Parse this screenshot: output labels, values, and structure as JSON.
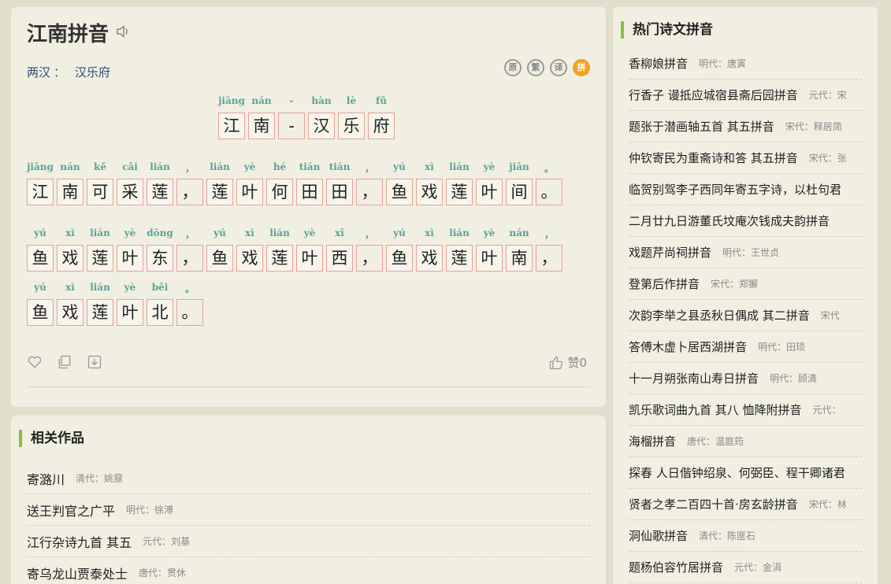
{
  "poem": {
    "title": "江南拼音",
    "dynasty": "两汉",
    "meta_sep": "：",
    "author": "汉乐府",
    "tools": [
      "原",
      "繁",
      "译",
      "拼"
    ],
    "title_line": {
      "py": [
        "jiāng",
        "nán",
        "-",
        "hàn",
        "lè",
        "fǔ"
      ],
      "hz": [
        "江",
        "南",
        "-",
        "汉",
        "乐",
        "府"
      ]
    },
    "lines": [
      {
        "py": [
          "jiāng",
          "nán",
          "kě",
          "cǎi",
          "lián",
          "，",
          "lián",
          "yè",
          "hé",
          "tián",
          "tián",
          "，",
          "yú",
          "xì",
          "lián",
          "yè",
          "jiān",
          "。"
        ],
        "hz": [
          "江",
          "南",
          "可",
          "采",
          "莲",
          "，",
          "莲",
          "叶",
          "何",
          "田",
          "田",
          "，",
          "鱼",
          "戏",
          "莲",
          "叶",
          "间",
          "。"
        ]
      },
      {
        "py": [
          "yú",
          "xì",
          "lián",
          "yè",
          "dōng",
          "，",
          "yú",
          "xì",
          "lián",
          "yè",
          "xī",
          "，",
          "yú",
          "xì",
          "lián",
          "yè",
          "nán",
          "，"
        ],
        "hz": [
          "鱼",
          "戏",
          "莲",
          "叶",
          "东",
          "，",
          "鱼",
          "戏",
          "莲",
          "叶",
          "西",
          "，",
          "鱼",
          "戏",
          "莲",
          "叶",
          "南",
          "，"
        ]
      },
      {
        "py": [
          "yú",
          "xì",
          "lián",
          "yè",
          "běi",
          "。"
        ],
        "hz": [
          "鱼",
          "戏",
          "莲",
          "叶",
          "北",
          "。"
        ]
      }
    ],
    "like_label": "赞0"
  },
  "related": {
    "title": "相关作品",
    "items": [
      {
        "title": "寄潞川",
        "author": "清代：姚鼐"
      },
      {
        "title": "送王判官之广平",
        "author": "明代：徐溥"
      },
      {
        "title": "江行杂诗九首 其五",
        "author": "元代：刘基"
      },
      {
        "title": "寄乌龙山贾泰处士",
        "author": "唐代：贯休"
      }
    ]
  },
  "hot": {
    "title": "热门诗文拼音",
    "items": [
      {
        "title": "香柳娘拼音",
        "author": "明代：唐寅"
      },
      {
        "title": "行香子 谩抵应城宿县斋后园拼音",
        "author": "元代：宋"
      },
      {
        "title": "题张于潜画轴五首 其五拼音",
        "author": "宋代：释居简"
      },
      {
        "title": "仲钦寄民为重斋诗和答 其五拼音",
        "author": "宋代：张"
      },
      {
        "title": "临贺别驾李子西同年寄五字诗，以杜句君",
        "author": ""
      },
      {
        "title": "二月廿九日游董氏坟庵次钱成夫韵拼音",
        "author": ""
      },
      {
        "title": "戏题芹尚祠拼音",
        "author": "明代：王世贞"
      },
      {
        "title": "登第后作拼音",
        "author": "宋代：郑獬"
      },
      {
        "title": "次韵李举之县丞秋日偶成 其二拼音",
        "author": "宋代"
      },
      {
        "title": "答傅木虚卜居西湖拼音",
        "author": "明代：田顼"
      },
      {
        "title": "十一月朔张南山寿日拼音",
        "author": "明代：顾清"
      },
      {
        "title": "凯乐歌词曲九首 其八 恤降附拼音",
        "author": "元代："
      },
      {
        "title": "海榴拼音",
        "author": "唐代：温庭筠"
      },
      {
        "title": "探春 人日偕钟绍泉、何弼臣、程干卿诸君",
        "author": ""
      },
      {
        "title": "贤者之孝二百四十首·房玄龄拼音",
        "author": "宋代：林"
      },
      {
        "title": "洞仙歌拼音",
        "author": "清代：陈匪石"
      },
      {
        "title": "题杨伯容竹居拼音",
        "author": "元代：金涓"
      }
    ]
  },
  "colors": {
    "accent_green": "#8bbf3a",
    "pinyin": "#59a39a",
    "grid_border": "#e8a09a",
    "active_tool": "#f0a324"
  }
}
